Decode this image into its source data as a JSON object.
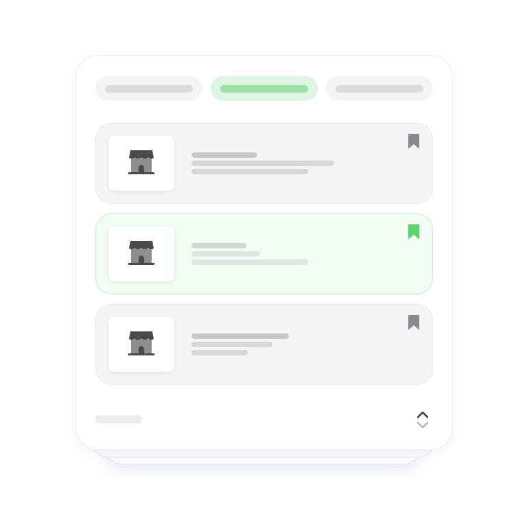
{
  "tabs": [
    {
      "id": "tab-1",
      "active": false
    },
    {
      "id": "tab-2",
      "active": true
    },
    {
      "id": "tab-3",
      "active": false
    }
  ],
  "listings": [
    {
      "icon": "storefront-icon",
      "bookmarked": false
    },
    {
      "icon": "storefront-icon",
      "bookmarked": true
    },
    {
      "icon": "storefront-icon",
      "bookmarked": false
    }
  ],
  "footer": {
    "sort_control": "chevron-up-down-icon"
  },
  "colors": {
    "accent": "#5cd56b",
    "accent_soft": "#def5e2",
    "bookmark_inactive": "#8a8a8e",
    "icon": "#4a4a4d"
  }
}
